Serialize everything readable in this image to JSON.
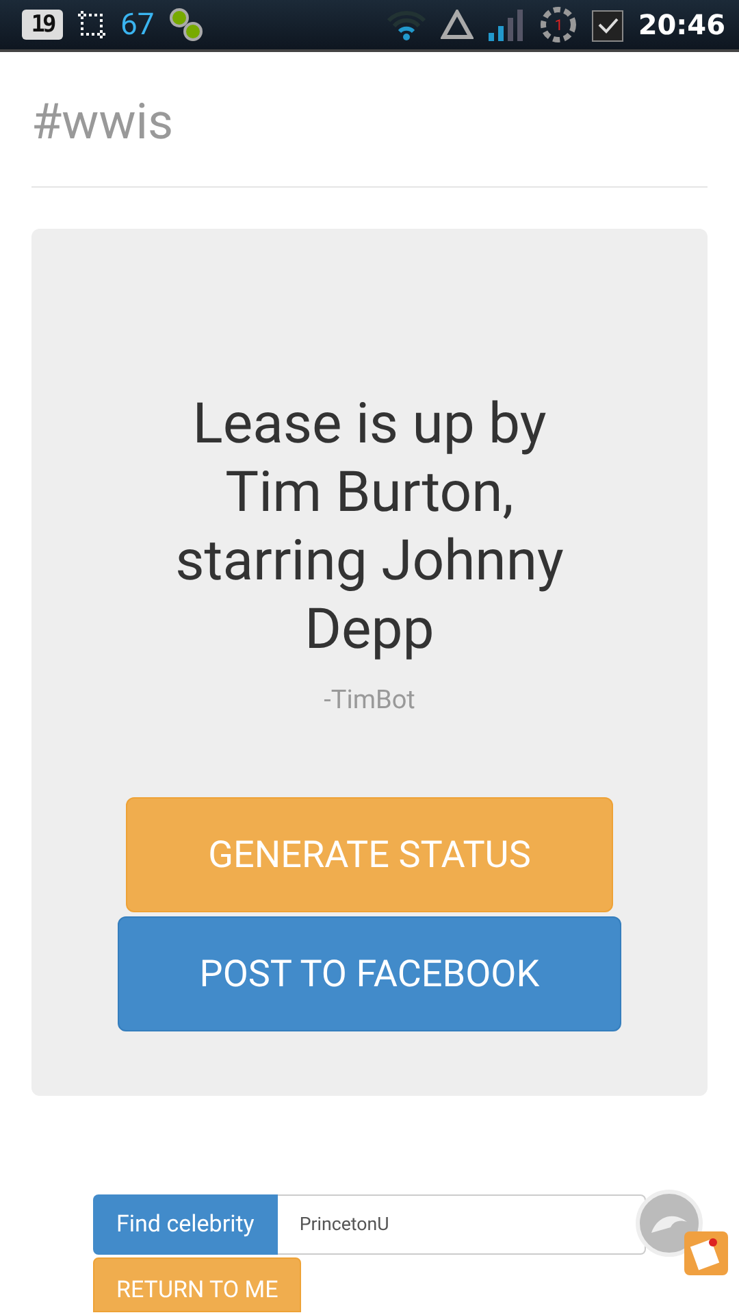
{
  "status_bar": {
    "battery_text": "19",
    "notification_count": "67",
    "alarm_badge": "1",
    "time": "20:46"
  },
  "page": {
    "title": "#wwis"
  },
  "card": {
    "quote": "Lease is up by Tim Burton, starring Johnny Depp",
    "author": "-TimBot",
    "buttons": [
      {
        "label": "GENERATE STATUS",
        "kind": "warning"
      },
      {
        "label": "POST TO FACEBOOK",
        "kind": "primary"
      }
    ]
  },
  "search": {
    "addon": "Find celebrity",
    "value": "PrincetonU"
  },
  "return_button": {
    "label": "RETURN TO ME"
  }
}
